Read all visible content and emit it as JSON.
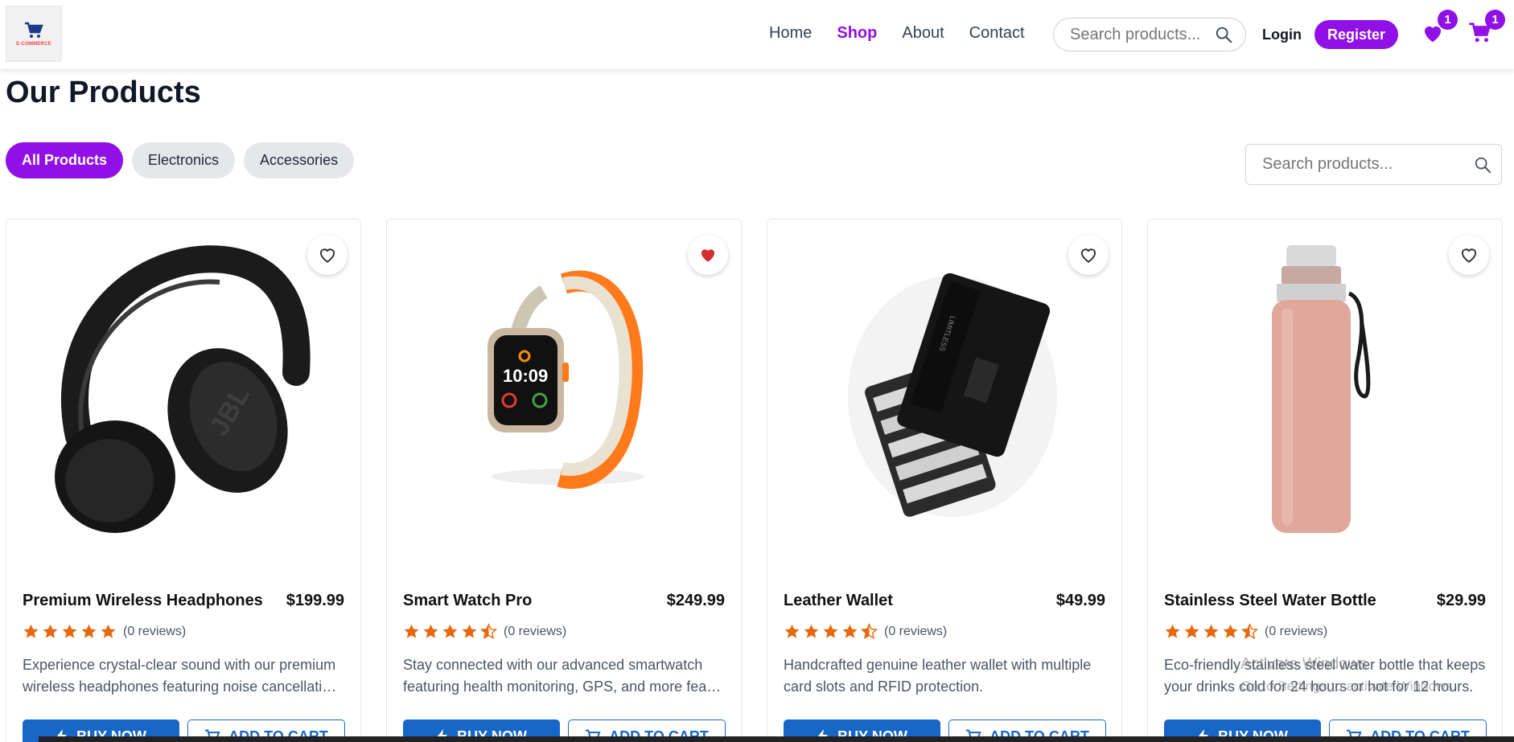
{
  "header": {
    "logo_text": "E-COMMERCE",
    "nav": [
      {
        "label": "Home",
        "active": false
      },
      {
        "label": "Shop",
        "active": true
      },
      {
        "label": "About",
        "active": false
      },
      {
        "label": "Contact",
        "active": false
      }
    ],
    "search_placeholder": "Search products...",
    "login_label": "Login",
    "register_label": "Register",
    "wishlist_count": "1",
    "cart_count": "1"
  },
  "page": {
    "title": "Our Products",
    "filters": [
      "All Products",
      "Electronics",
      "Accessories"
    ],
    "active_filter": "All Products",
    "search_placeholder": "Search products..."
  },
  "products": [
    {
      "name": "Premium Wireless Headphones",
      "price": "$199.99",
      "rating": 5,
      "reviews": "(0 reviews)",
      "desc_line1": "Experience crystal-clear sound with our premium",
      "desc_line2": "wireless headphones featuring noise cancellation technology",
      "favorited": false,
      "buy_label": "BUY NOW",
      "cart_label": "ADD TO CART",
      "image_icon": "headphones-image"
    },
    {
      "name": "Smart Watch Pro",
      "price": "$249.99",
      "rating": 4.5,
      "reviews": "(0 reviews)",
      "desc_line1": "Stay connected with our advanced smartwatch",
      "desc_line2": "featuring health monitoring, GPS, and more features",
      "favorited": true,
      "buy_label": "BUY NOW",
      "cart_label": "ADD TO CART",
      "image_icon": "smartwatch-image"
    },
    {
      "name": "Leather Wallet",
      "price": "$49.99",
      "rating": 4.5,
      "reviews": "(0 reviews)",
      "desc_line1": "Handcrafted genuine leather wallet with multiple",
      "desc_line2": "card slots and RFID protection.",
      "favorited": false,
      "buy_label": "BUY NOW",
      "cart_label": "ADD TO CART",
      "image_icon": "wallet-image"
    },
    {
      "name": "Stainless Steel Water Bottle",
      "price": "$29.99",
      "rating": 4.5,
      "reviews": "(0 reviews)",
      "desc_line1": "Eco-friendly stainless steel water bottle that keeps",
      "desc_line2": "your drinks cold for 24 hours or hot for 12 hours.",
      "favorited": false,
      "buy_label": "BUY NOW",
      "cart_label": "ADD TO CART",
      "image_icon": "water-bottle-image"
    }
  ],
  "watermark": {
    "title": "Activate Windows",
    "subtitle": "Go to Settings to activate Windows."
  },
  "colors": {
    "accent": "#9010e6",
    "button_blue": "#1767c8",
    "star": "#e8680c",
    "heart_active": "#d32f2f"
  }
}
